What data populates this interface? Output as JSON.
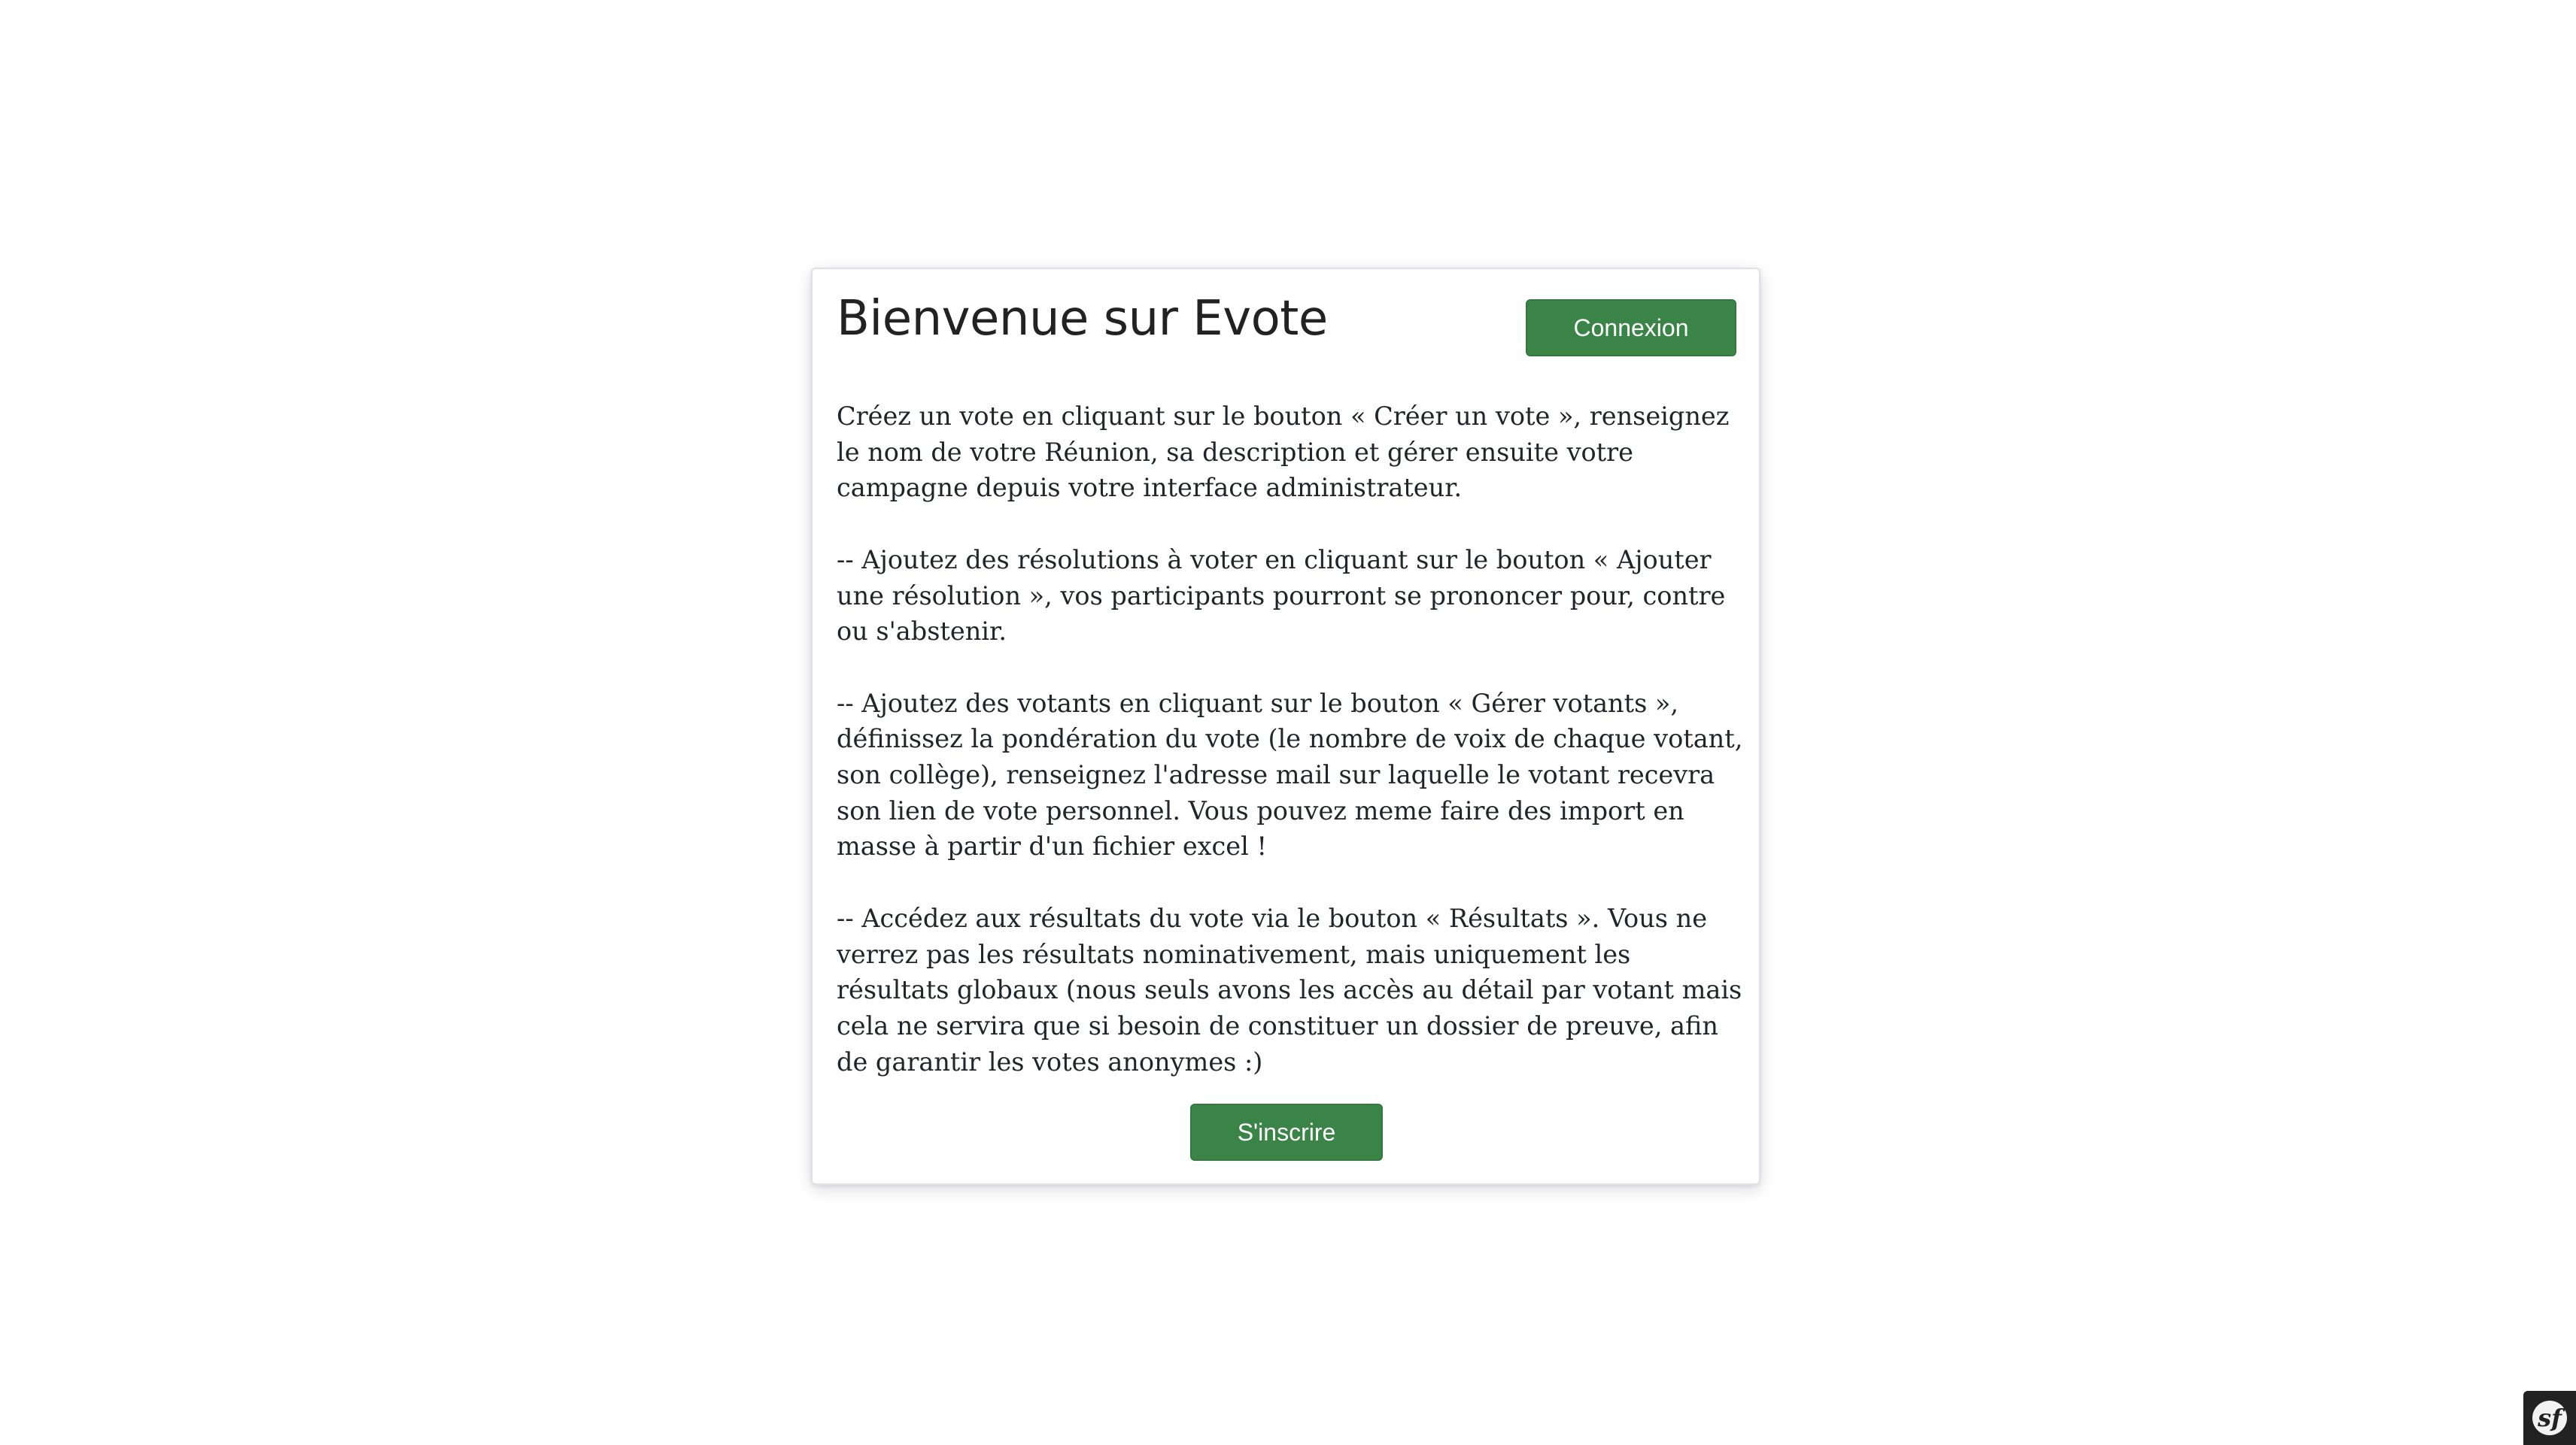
{
  "card": {
    "title": "Bienvenue sur Evote",
    "login_button": "Connexion",
    "paragraphs": [
      "Créez un vote en cliquant sur le bouton « Créer un vote », renseignez le nom de votre Réunion, sa description et gérer ensuite votre campagne depuis votre interface administrateur.",
      "-- Ajoutez des résolutions à voter en cliquant sur le bouton « Ajouter une résolution », vos participants pourront se prononcer pour, contre ou s'abstenir.",
      "-- Ajoutez des votants en cliquant sur le bouton « Gérer votants », définissez la pondération du vote (le nombre de voix de chaque votant, son collège), renseignez l'adresse mail sur laquelle le votant recevra son lien de vote personnel. Vous pouvez meme faire des import en masse à partir d'un fichier excel !",
      "-- Accédez aux résultats du vote via le bouton « Résultats ». Vous ne verrez pas les résultats nominativement, mais uniquement les résultats globaux (nous seuls avons les accès au détail par votant mais cela ne servira que si besoin de constituer un dossier de preuve, afin de garantir les votes anonymes :)"
    ],
    "register_button": "S'inscrire"
  },
  "debug_toolbar": {
    "icon": "symfony-logo-icon",
    "glyph": "sf"
  },
  "colors": {
    "button_bg": "#3b8448",
    "button_text": "#ffffff",
    "page_bg": "#ffffff",
    "text": "#212529"
  }
}
